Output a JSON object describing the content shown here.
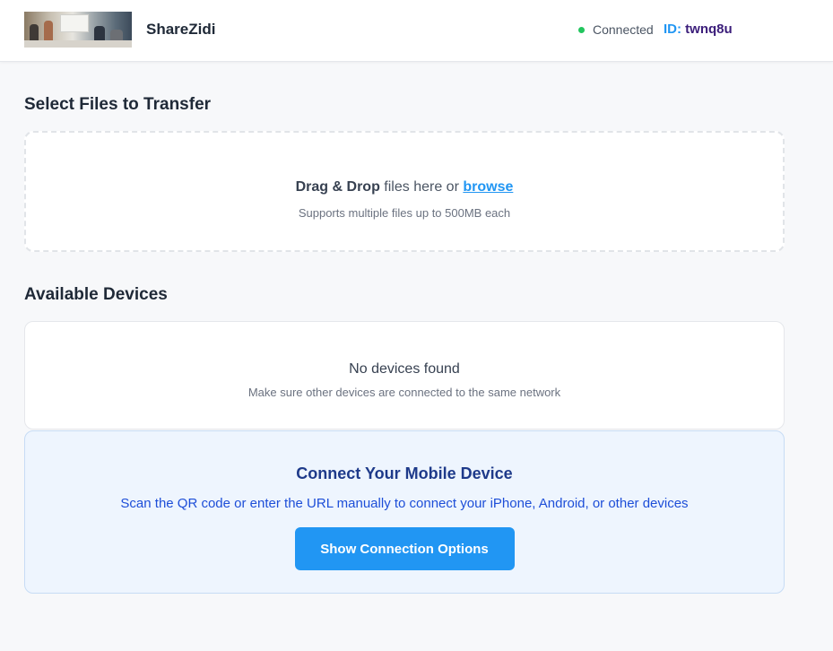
{
  "header": {
    "app_name": "ShareZidi",
    "status_text": "Connected",
    "id_label": "ID:",
    "id_value": "twnq8u"
  },
  "upload": {
    "title": "Select Files to Transfer",
    "drag_drop_bold": "Drag & Drop",
    "drag_drop_rest": " files here or ",
    "browse_link": "browse",
    "support_text": "Supports multiple files up to 500MB each"
  },
  "devices": {
    "title": "Available Devices",
    "empty_title": "No devices found",
    "empty_hint": "Make sure other devices are connected to the same network"
  },
  "mobile": {
    "title": "Connect Your Mobile Device",
    "description": "Scan the QR code or enter the URL manually to connect your iPhone, Android, or other devices",
    "button_label": "Show Connection Options"
  },
  "colors": {
    "accent": "#2196f3",
    "status_ok": "#22c55e",
    "mobile_bg": "#eef5fe"
  }
}
